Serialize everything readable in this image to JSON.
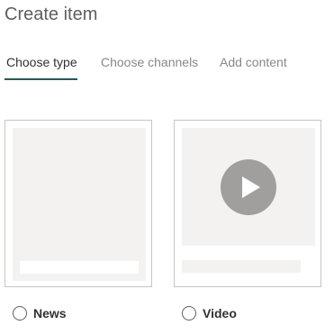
{
  "dialog": {
    "title": "Create item"
  },
  "tabs": [
    {
      "label": "Choose type",
      "active": true
    },
    {
      "label": "Choose channels",
      "active": false
    },
    {
      "label": "Add content",
      "active": false
    }
  ],
  "options": [
    {
      "label": "News",
      "selected": false,
      "thumbnail_icon": null
    },
    {
      "label": "Video",
      "selected": false,
      "thumbnail_icon": "play-icon"
    }
  ],
  "colors": {
    "active_tab_underline": "#1f5c5a",
    "placeholder_fill": "#f3f2f1",
    "play_button": "#a19f9d"
  }
}
